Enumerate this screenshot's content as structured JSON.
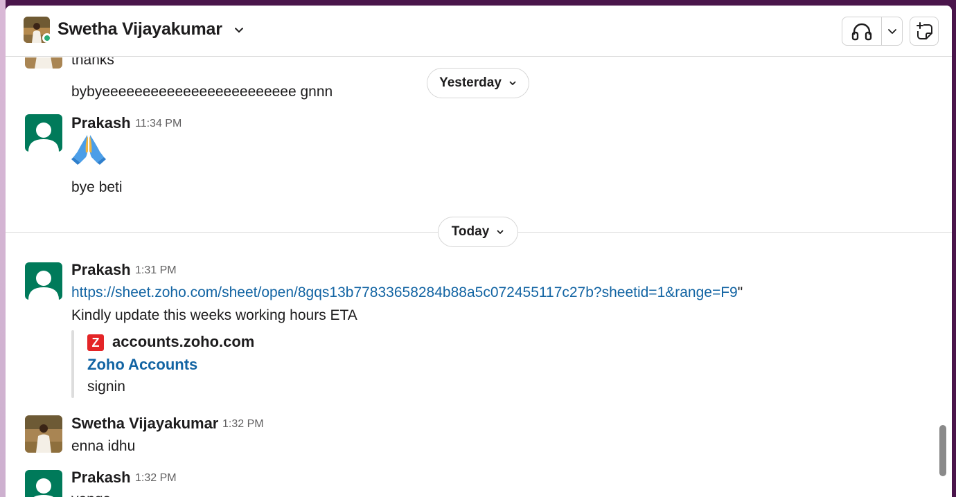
{
  "header": {
    "channel_name": "Swetha Vijayakumar"
  },
  "date_dividers": {
    "yesterday": "Yesterday",
    "today": "Today"
  },
  "messages": {
    "m0": {
      "text": "thanks"
    },
    "m1": {
      "text": "bybyeeeeeeeeeeeeeeeeeeeeeeee gnnn"
    },
    "m2": {
      "author": "Prakash",
      "time": "11:34 PM",
      "emoji": "folded hands",
      "text": "bye beti"
    },
    "m3": {
      "author": "Prakash",
      "time": "1:31 PM",
      "link": "https://sheet.zoho.com/sheet/open/8gqs13b77833658284b88a5c072455117c27b?sheetid=1&range=F9",
      "link_suffix": "\"",
      "text": "Kindly update this weeks working hours ETA",
      "preview": {
        "icon_letter": "Z",
        "domain": "accounts.zoho.com",
        "title": "Zoho Accounts",
        "description": "signin"
      }
    },
    "m4": {
      "author": "Swetha Vijayakumar",
      "time": "1:32 PM",
      "text": "enna idhu"
    },
    "m5": {
      "author": "Prakash",
      "time": "1:32 PM",
      "text": "venga"
    }
  },
  "colors": {
    "accent_link": "#1264a3",
    "presence_online": "#2bac76",
    "default_avatar": "#007a5a",
    "zoho_red": "#e42527"
  }
}
